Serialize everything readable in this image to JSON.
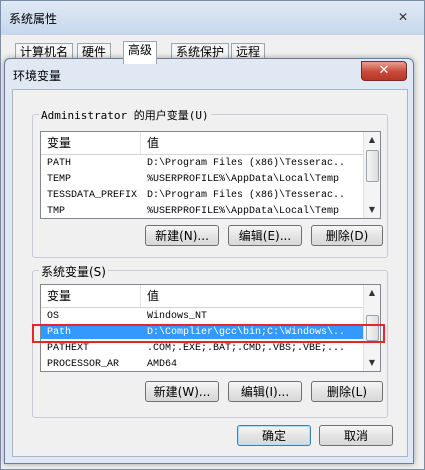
{
  "outer": {
    "title": "系统属性",
    "close": "✕",
    "tabs": [
      "计算机名",
      "硬件",
      "高级",
      "系统保护",
      "远程"
    ],
    "active_tab": "高级"
  },
  "dialog": {
    "title": "环境变量",
    "close": "✕",
    "user_group": {
      "label": "Administrator 的用户变量(U)",
      "col_var": "变量",
      "col_val": "值",
      "rows": [
        {
          "name": "PATH",
          "value": "D:\\Program Files (x86)\\Tesserac..."
        },
        {
          "name": "TEMP",
          "value": "%USERPROFILE%\\AppData\\Local\\Temp"
        },
        {
          "name": "TESSDATA_PREFIX",
          "value": "D:\\Program Files (x86)\\Tesserac..."
        },
        {
          "name": "TMP",
          "value": "%USERPROFILE%\\AppData\\Local\\Temp"
        }
      ],
      "buttons": {
        "new": "新建(N)...",
        "edit": "编辑(E)...",
        "delete": "删除(D)"
      }
    },
    "system_group": {
      "label": "系统变量(S)",
      "col_var": "变量",
      "col_val": "值",
      "rows": [
        {
          "name": "OS",
          "value": "Windows_NT"
        },
        {
          "name": "Path",
          "value": "D:\\Complier\\gcc\\bin;C:\\Windows\\..."
        },
        {
          "name": "PATHEXT",
          "value": ".COM;.EXE;.BAT;.CMD;.VBS;.VBE;..."
        },
        {
          "name": "PROCESSOR_AR",
          "value": "AMD64"
        }
      ],
      "selected_row": 1,
      "buttons": {
        "new": "新建(W)...",
        "edit": "编辑(I)...",
        "delete": "删除(L)"
      }
    },
    "ok": "确定",
    "cancel": "取消"
  },
  "colors": {
    "selection": "#3399ff",
    "highlight_border": "#e8242a"
  }
}
